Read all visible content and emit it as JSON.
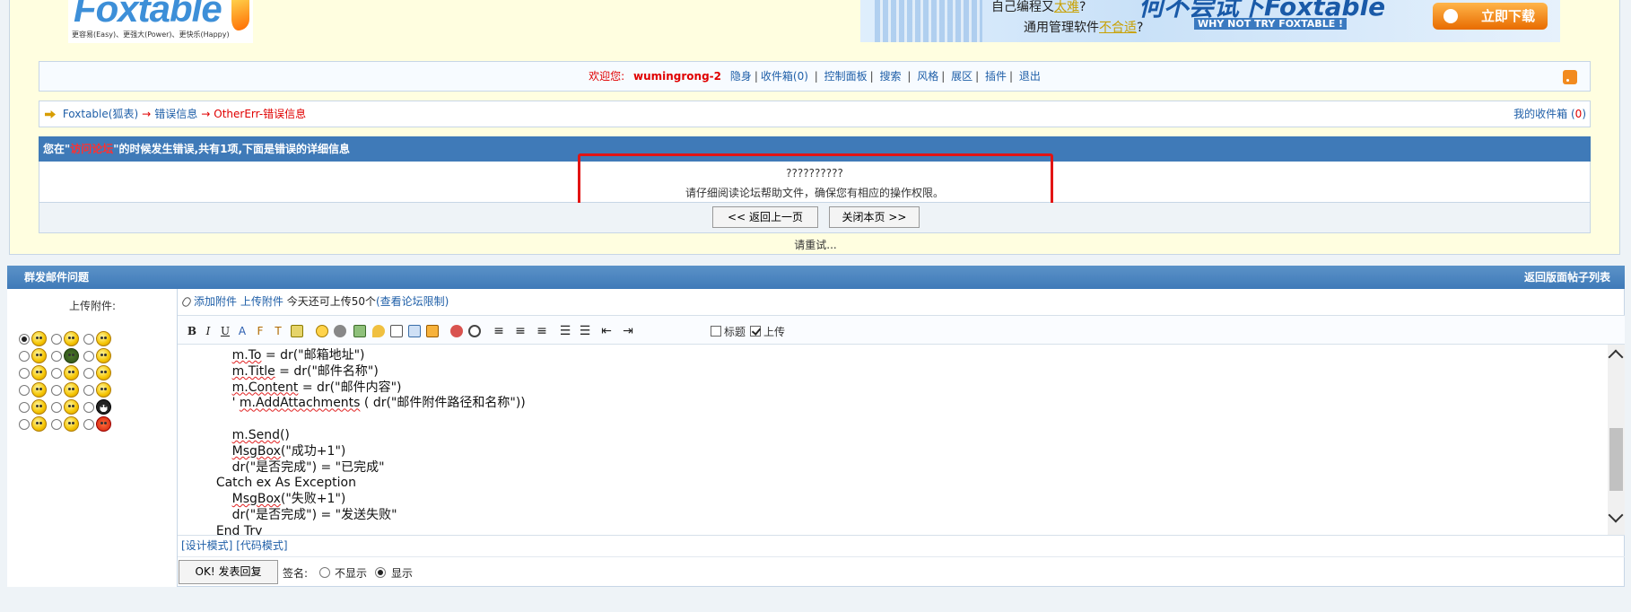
{
  "logo": {
    "text": "Foxtable",
    "slogan": "更容易(Easy)、更强大(Power)、更快乐(Happy)"
  },
  "banner": {
    "line1_prefix": "自己编程又",
    "line1_hl": "太难",
    "line1_suffix": "?",
    "line2_prefix": "通用管理软件",
    "line2_hl": "不合适",
    "line2_suffix": "?",
    "big": "何不尝试下Foxtable",
    "sub": "WHY NOT TRY FOXTABLE !",
    "download": "立即下载"
  },
  "userbar": {
    "welcome": "欢迎您:",
    "username": "wumingrong-2",
    "links": [
      "隐身",
      "收件箱(0)",
      "控制面板",
      "搜索",
      "风格",
      "展区",
      "插件",
      "退出"
    ]
  },
  "breadcrumb": {
    "items": [
      "Foxtable(狐表)",
      "错误信息",
      "OtherErr-错误信息"
    ],
    "arrow": "→",
    "inbox_prefix": "我的收件箱 (",
    "inbox_count": "0",
    "inbox_suffix": ")"
  },
  "error": {
    "head_prefix": "您在\"",
    "head_hl": "访问论坛",
    "head_suffix": "\"的时候发生错误,共有1项,下面是错误的详细信息",
    "line1": "??????????",
    "line2": "请仔细阅读论坛帮助文件，确保您有相应的操作权限。",
    "back_button": "<< 返回上一页",
    "close_button": "关闭本页 >>",
    "retry": "请重试..."
  },
  "reply": {
    "title": "群发邮件问题",
    "back_to_list": "返回版面帖子列表",
    "upload_label": "上传附件:",
    "add_attach": "添加附件",
    "upload_attach": "上传附件",
    "quota_text": "今天还可上传50个",
    "view_limit": "(查看论坛限制)",
    "title_checkbox": "标题",
    "upload_checkbox": "上传",
    "code": [
      {
        "indent": "        ",
        "sq": "m.To",
        "rest": " = dr(\"邮箱地址\")"
      },
      {
        "indent": "        ",
        "sq": "m.Title",
        "rest": " = dr(\"邮件名称\")"
      },
      {
        "indent": "        ",
        "sq": "m.Content",
        "rest": " = dr(\"邮件内容\")"
      },
      {
        "indent": "        ' ",
        "sq": "m.AddAttachments",
        "rest": " ( dr(\"邮件附件路径和名称\"))"
      },
      {
        "indent": "",
        "sq": "",
        "rest": ""
      },
      {
        "indent": "        ",
        "sq": "m.Send",
        "rest": "()"
      },
      {
        "indent": "        ",
        "sq": "MsgBox",
        "rest": "(\"成功+1\")"
      },
      {
        "indent": "        ",
        "sq": "",
        "rest": "dr(\"是否完成\") = \"已完成\""
      },
      {
        "indent": "    ",
        "sq": "",
        "rest": "Catch ex As Exception"
      },
      {
        "indent": "        ",
        "sq": "MsgBox",
        "rest": "(\"失败+1\")"
      },
      {
        "indent": "        ",
        "sq": "",
        "rest": "dr(\"是否完成\") = \"发送失败\""
      },
      {
        "indent": "    ",
        "sq": "",
        "rest": "End Try"
      }
    ],
    "design_mode": "[设计模式]",
    "code_mode": "[代码模式]",
    "submit": "OK! 发表回复",
    "signature_label": "签名:",
    "sig_hide": "不显示",
    "sig_show": "显示"
  },
  "colors": {
    "header_blue": "#3f7ab8",
    "accent_red": "#e00000",
    "link_blue": "#1f5fa8",
    "panel_yellow": "#fffee0"
  }
}
